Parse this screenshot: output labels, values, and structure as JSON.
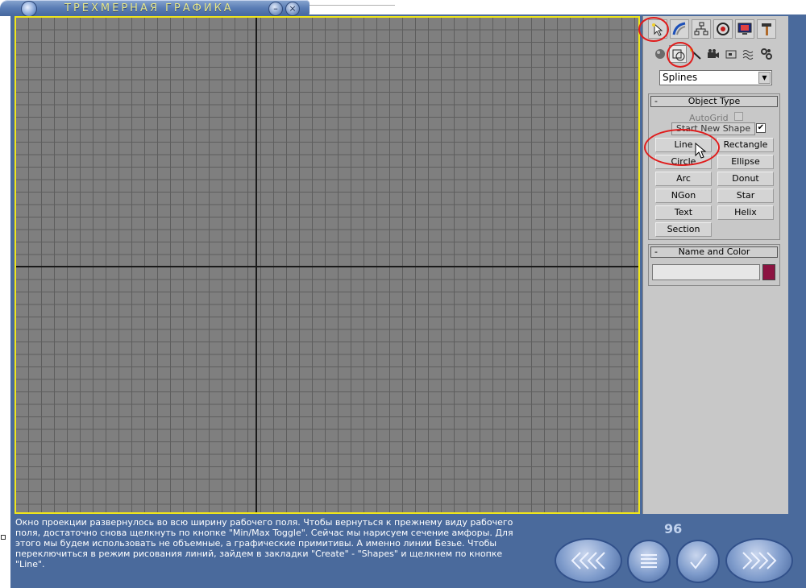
{
  "window": {
    "title": "ТРЕХМЕРНАЯ ГРАФИКА",
    "minimize_symbol": "–",
    "close_symbol": "×"
  },
  "command_panel": {
    "tabs": [
      {
        "name": "create-tab",
        "icon": "cursor-star-icon"
      },
      {
        "name": "modify-tab",
        "icon": "curve-icon"
      },
      {
        "name": "hierarchy-tab",
        "icon": "hierarchy-icon"
      },
      {
        "name": "motion-tab",
        "icon": "motion-icon"
      },
      {
        "name": "display-tab",
        "icon": "display-icon"
      },
      {
        "name": "utilities-tab",
        "icon": "hammer-icon"
      }
    ],
    "subtabs": [
      {
        "name": "geometry-subtab",
        "icon": "sphere-icon"
      },
      {
        "name": "shapes-subtab",
        "icon": "shapes-icon"
      },
      {
        "name": "lights-subtab",
        "icon": "light-icon"
      },
      {
        "name": "cameras-subtab",
        "icon": "camera-icon"
      },
      {
        "name": "helpers-subtab",
        "icon": "helper-icon"
      },
      {
        "name": "spacewarps-subtab",
        "icon": "wave-icon"
      },
      {
        "name": "systems-subtab",
        "icon": "gears-icon"
      }
    ],
    "category_dropdown": {
      "value": "Splines",
      "arrow": "▼"
    },
    "object_type": {
      "header": "Object Type",
      "collapse_symbol": "-",
      "autogrid_label": "AutoGrid",
      "start_new_shape_label": "Start New Shape",
      "start_new_shape_checked": "✔",
      "buttons": [
        "Line",
        "Rectangle",
        "Circle",
        "Ellipse",
        "Arc",
        "Donut",
        "NGon",
        "Star",
        "Text",
        "Helix",
        "Section"
      ]
    },
    "name_and_color": {
      "header": "Name and Color",
      "collapse_symbol": "-",
      "name_value": "",
      "color": "#8c1341"
    }
  },
  "footer": {
    "instruction": "Окно проекции развернулось во всю ширину рабочего поля. Чтобы вернуться к прежнему виду рабочего поля, достаточно снова щелкнуть по кнопке \"Min/Max Toggle\". Сейчас мы нарисуем сечение амфоры. Для этого мы будем использовать не объемные, а графические примитивы. А именно линии Безье. Чтобы переключиться в режим рисования линий, зайдем в закладки \"Create\" - \"Shapes\" и щелкнем по кнопке \"Line\".",
    "page_number": "96",
    "nav_buttons": [
      {
        "name": "back-button",
        "icon": "chevrons-left-icon"
      },
      {
        "name": "contents-button",
        "icon": "menu-lines-icon"
      },
      {
        "name": "check-button",
        "icon": "checkmark-icon"
      },
      {
        "name": "forward-button",
        "icon": "chevrons-right-icon"
      }
    ]
  },
  "colors": {
    "frame": "#4a6a9c",
    "viewport_border": "#f0e61a",
    "highlight_circle": "#e01c1c"
  }
}
